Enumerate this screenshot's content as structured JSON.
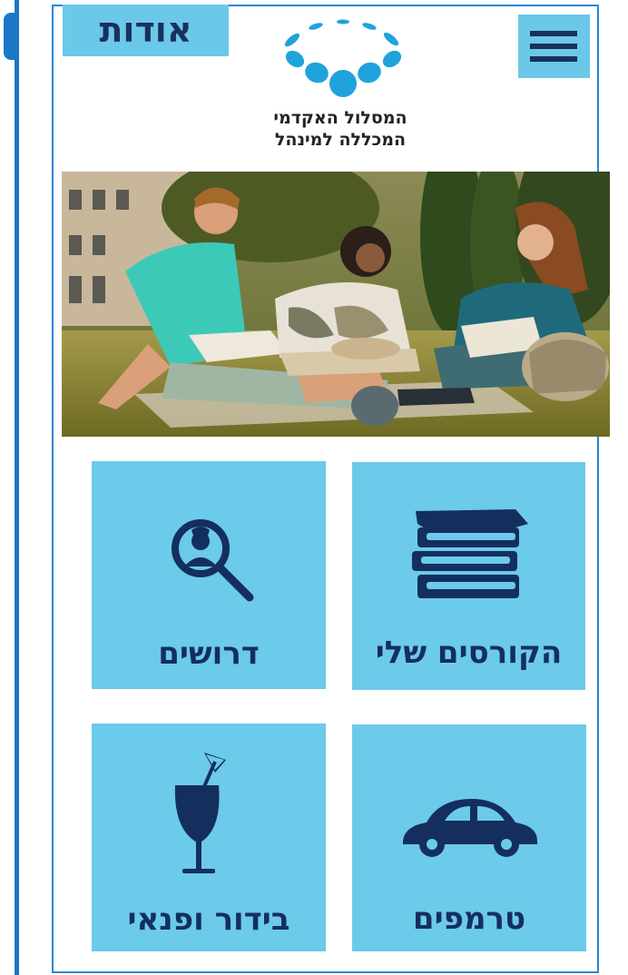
{
  "header": {
    "about_label": "אודות",
    "logo_line1": "המסלול האקדמי",
    "logo_line2": "המכללה למינהל"
  },
  "tiles": [
    {
      "label": "הקורסים שלי",
      "icon": "books-icon"
    },
    {
      "label": "דרושים",
      "icon": "job-search-icon"
    },
    {
      "label": "טרמפים",
      "icon": "car-icon"
    },
    {
      "label": "בידור ופנאי",
      "icon": "cocktail-icon"
    }
  ],
  "colors": {
    "tile_bg": "#6ccaea",
    "icon_navy": "#142f5e",
    "frame_blue": "#2e86d8",
    "logo_blue": "#1fa3dc"
  }
}
